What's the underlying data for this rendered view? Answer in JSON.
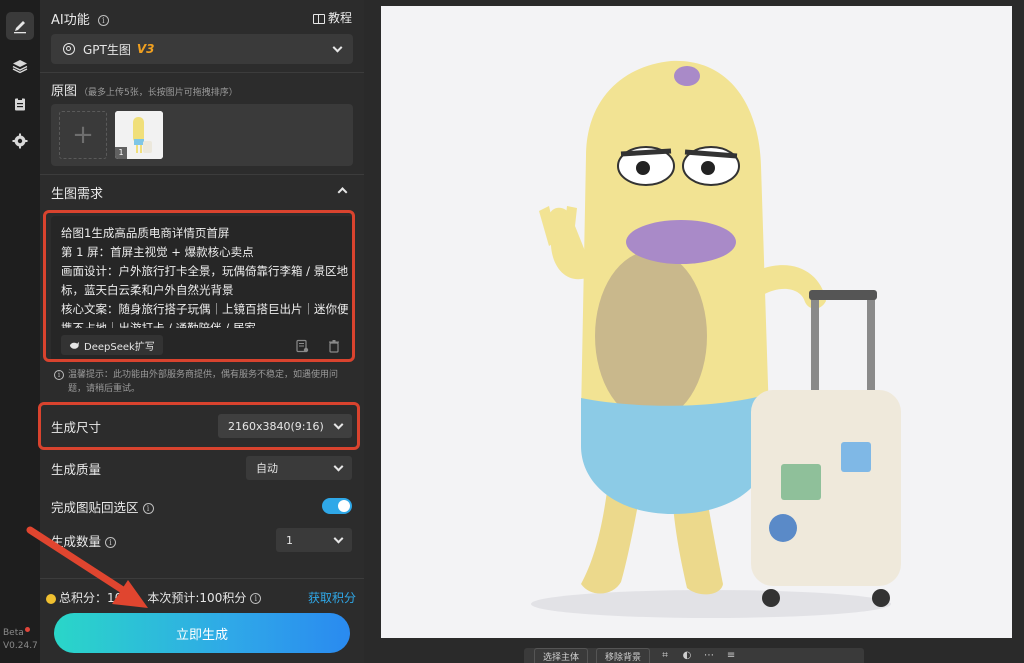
{
  "rail": {
    "footer_beta": "Beta",
    "footer_version": "V0.24.7"
  },
  "ai_function": {
    "title": "AI功能",
    "tutorial": "教程",
    "model_name": "GPT生图",
    "model_version": "V3"
  },
  "source": {
    "title": "原图",
    "note": "（最多上传5张，长按图片可拖拽排序）",
    "thumb_index": "1"
  },
  "requirements": {
    "title": "生图需求",
    "prompt": "给图1生成高品质电商详情页首屏\n第 1 屏：首屏主视觉 + 爆款核心卖点\n画面设计：户外旅行打卡全景，玩偶倚靠行李箱 / 景区地标，蓝天白云柔和户外自然光背景\n核心文案：随身旅行搭子玩偶｜上镜百搭巨出片｜迷你便携不占地｜出游打卡 / 通勤陪伴 / 居家",
    "deepseek_label": "DeepSeek扩写",
    "hint": "温馨提示：此功能由外部服务商提供，偶有服务不稳定，如遇使用问题，请稍后重试。"
  },
  "options": {
    "size_label": "生成尺寸",
    "size_value": "2160x3840(9:16)",
    "quality_label": "生成质量",
    "quality_value": "自动",
    "paste_back_label": "完成图贴回选区",
    "paste_back_on": true,
    "count_label": "生成数量",
    "count_value": "1"
  },
  "footer": {
    "total_points": "总积分：1049",
    "estimate": "本次预计:100积分",
    "get_points": "获取积分",
    "generate": "立即生成"
  },
  "canvas": {
    "toolbar": [
      "选择主体",
      "移除背景"
    ]
  },
  "colors": {
    "accent": "#2fa8e8",
    "highlight_outline": "#d9432e",
    "version_badge": "#f0a020"
  }
}
